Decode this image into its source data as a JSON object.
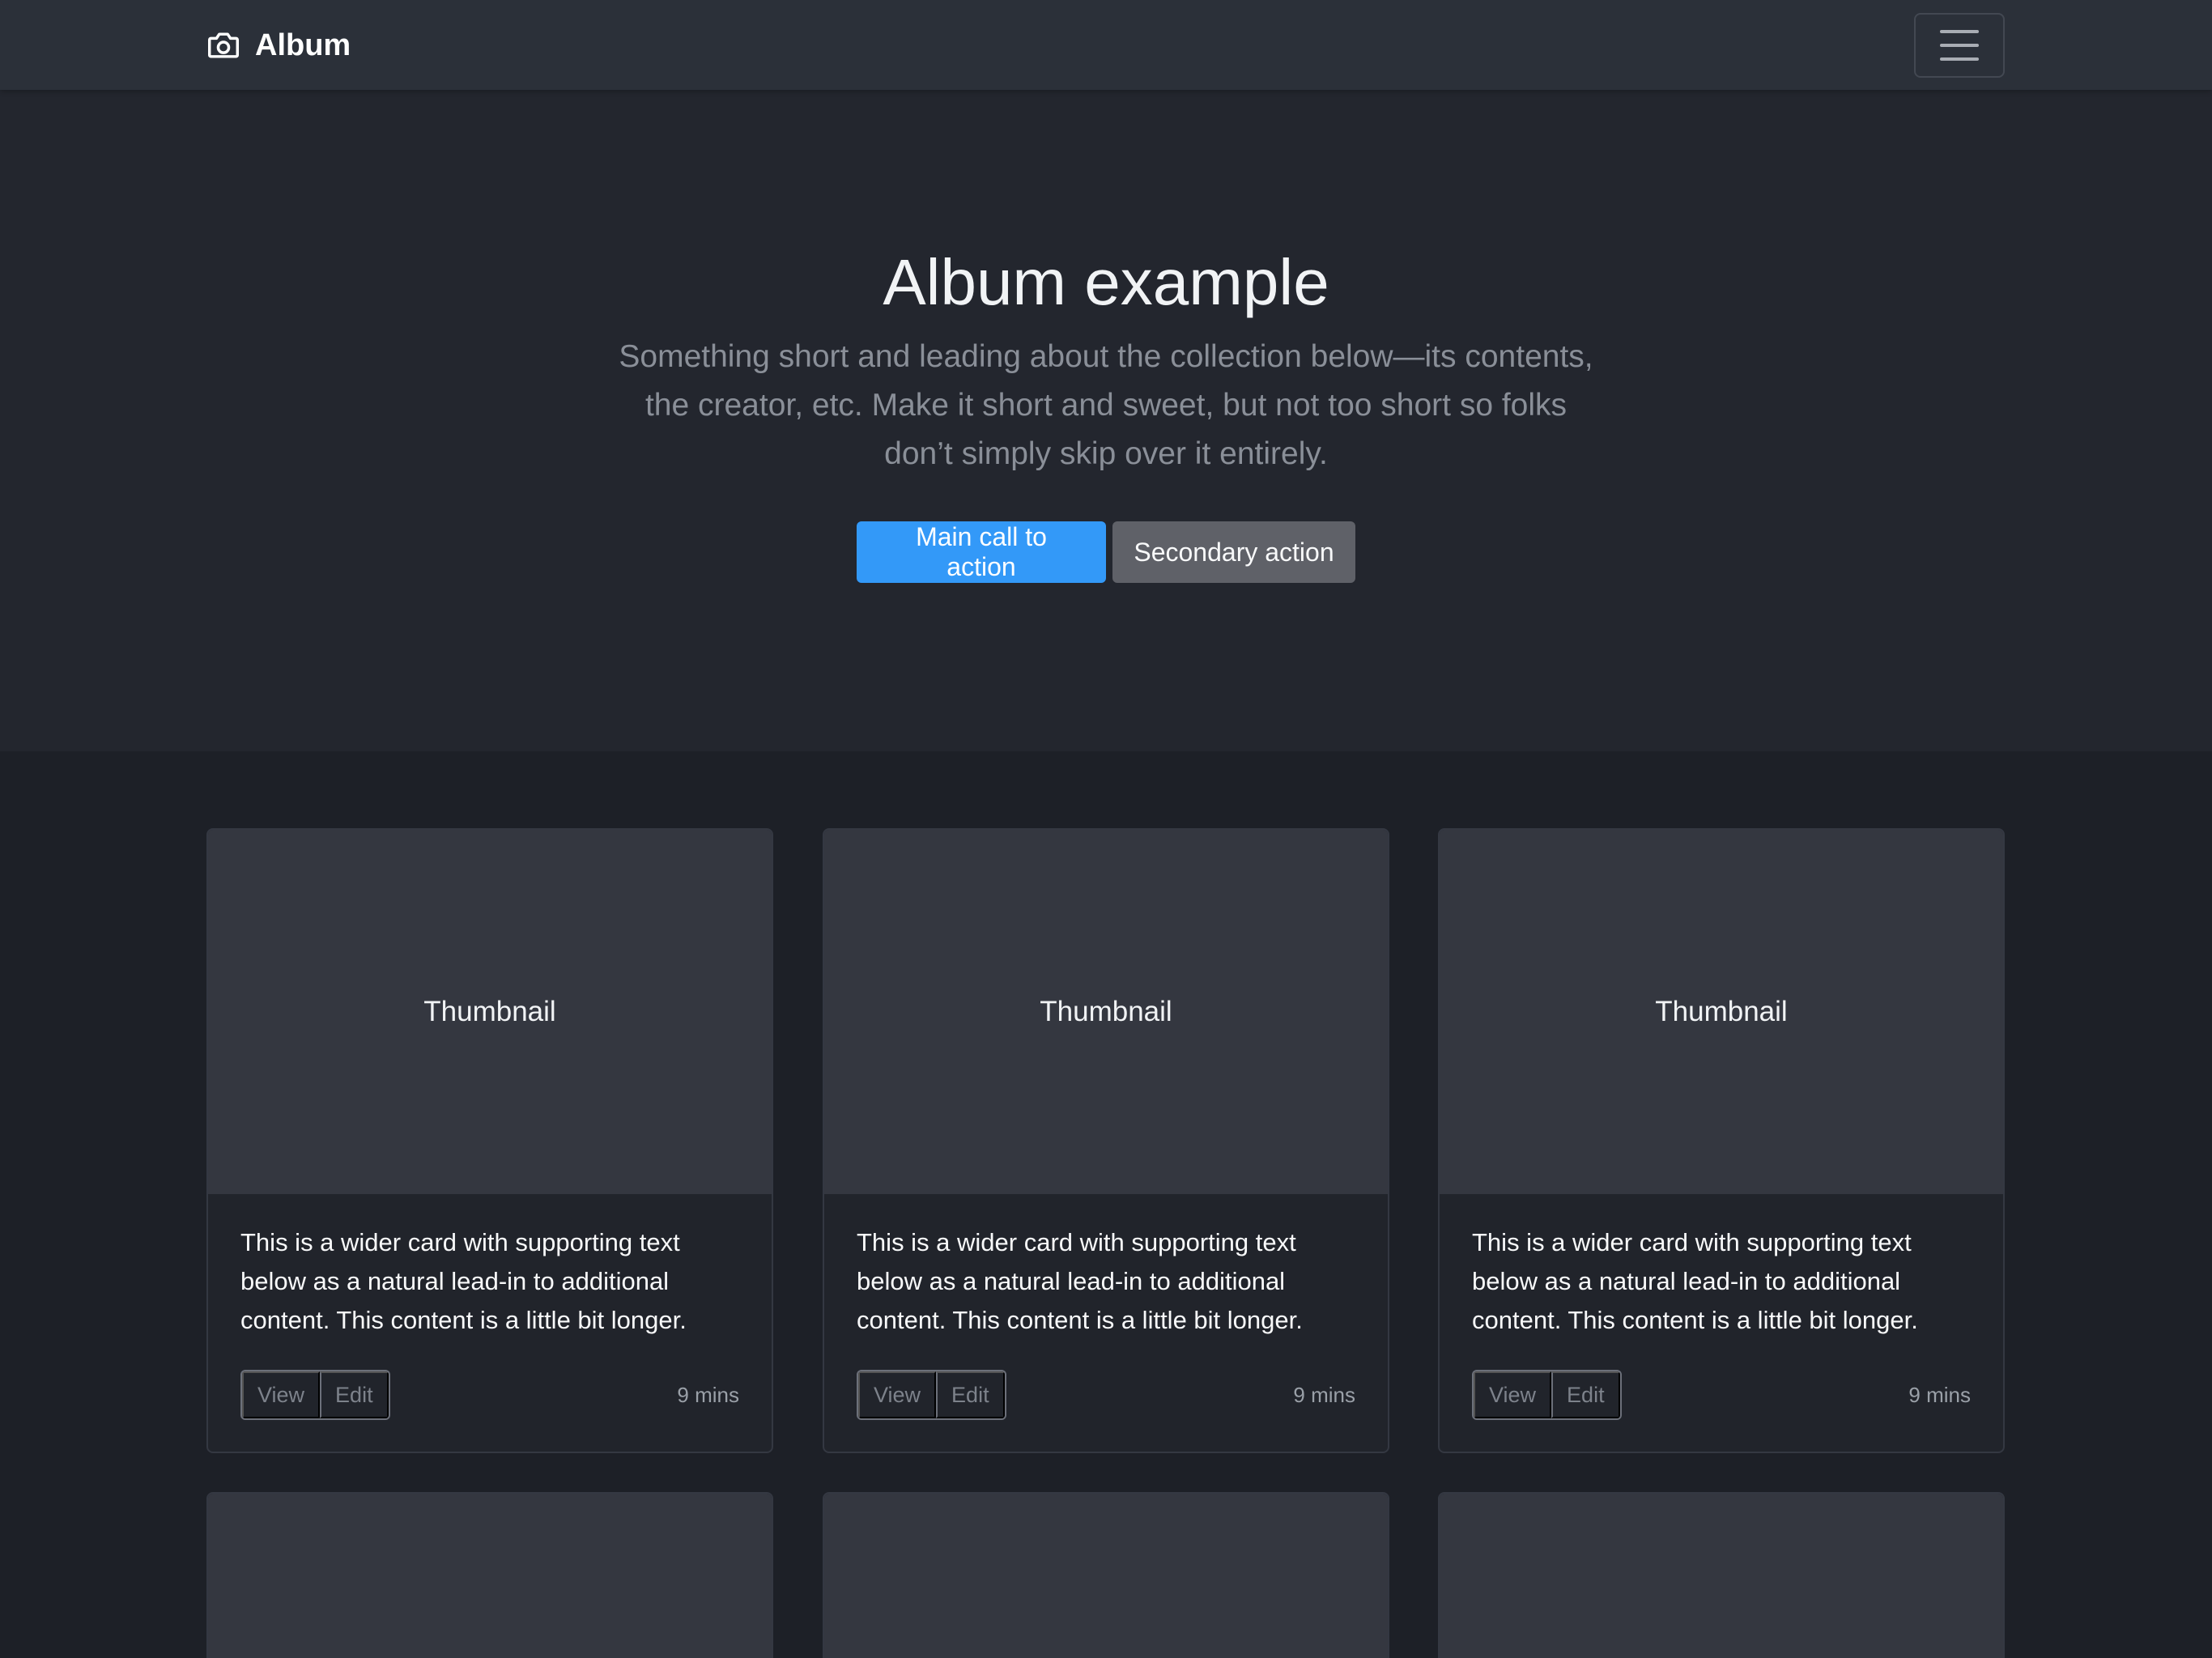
{
  "navbar": {
    "brand": "Album",
    "brand_icon": "camera-icon",
    "toggler_icon": "hamburger-icon"
  },
  "hero": {
    "title": "Album example",
    "lead": "Something short and leading about the collection below—its contents, the creator, etc. Make it short and sweet, but not too short so folks don’t simply skip over it entirely.",
    "primary_label": "Main call to action",
    "secondary_label": "Secondary action"
  },
  "colors": {
    "navbar_bg": "#2b3039",
    "hero_bg": "#23262e",
    "page_bg": "#1d2027",
    "primary": "#3399f8",
    "secondary": "#5f6168"
  },
  "cards": [
    {
      "thumbnail": "Thumbnail",
      "text": "This is a wider card with supporting text below as a natural lead-in to additional content. This content is a little bit longer.",
      "view_label": "View",
      "edit_label": "Edit",
      "time": "9 mins"
    },
    {
      "thumbnail": "Thumbnail",
      "text": "This is a wider card with supporting text below as a natural lead-in to additional content. This content is a little bit longer.",
      "view_label": "View",
      "edit_label": "Edit",
      "time": "9 mins"
    },
    {
      "thumbnail": "Thumbnail",
      "text": "This is a wider card with supporting text below as a natural lead-in to additional content. This content is a little bit longer.",
      "view_label": "View",
      "edit_label": "Edit",
      "time": "9 mins"
    }
  ]
}
